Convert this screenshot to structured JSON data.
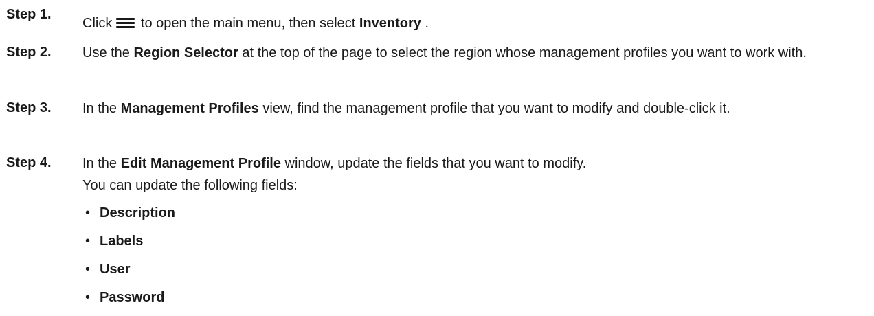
{
  "steps": [
    {
      "label": "Step 1.",
      "parts": {
        "t1": "Click",
        "icon": "hamburger-menu-icon",
        "t2": "to open the main menu, then select",
        "b1": "Inventory",
        "t3": "."
      }
    },
    {
      "label": "Step 2.",
      "parts": {
        "t1": "Use the",
        "b1": "Region Selector",
        "t2": "at the top of the page to select the region whose management profiles you want to work with."
      }
    },
    {
      "label": "Step 3.",
      "parts": {
        "t1": "In the",
        "b1": "Management Profiles",
        "t2": "view, find the management profile that you want to modify and double-click it."
      }
    },
    {
      "label": "Step 4.",
      "parts": {
        "t1": "In the",
        "b1": "Edit Management Profile",
        "t2": "window, update the fields that you want to modify."
      },
      "sub_text": "You can update the following fields:",
      "bullet": "•",
      "fields": [
        "Description",
        "Labels",
        "User",
        "Password"
      ]
    }
  ]
}
